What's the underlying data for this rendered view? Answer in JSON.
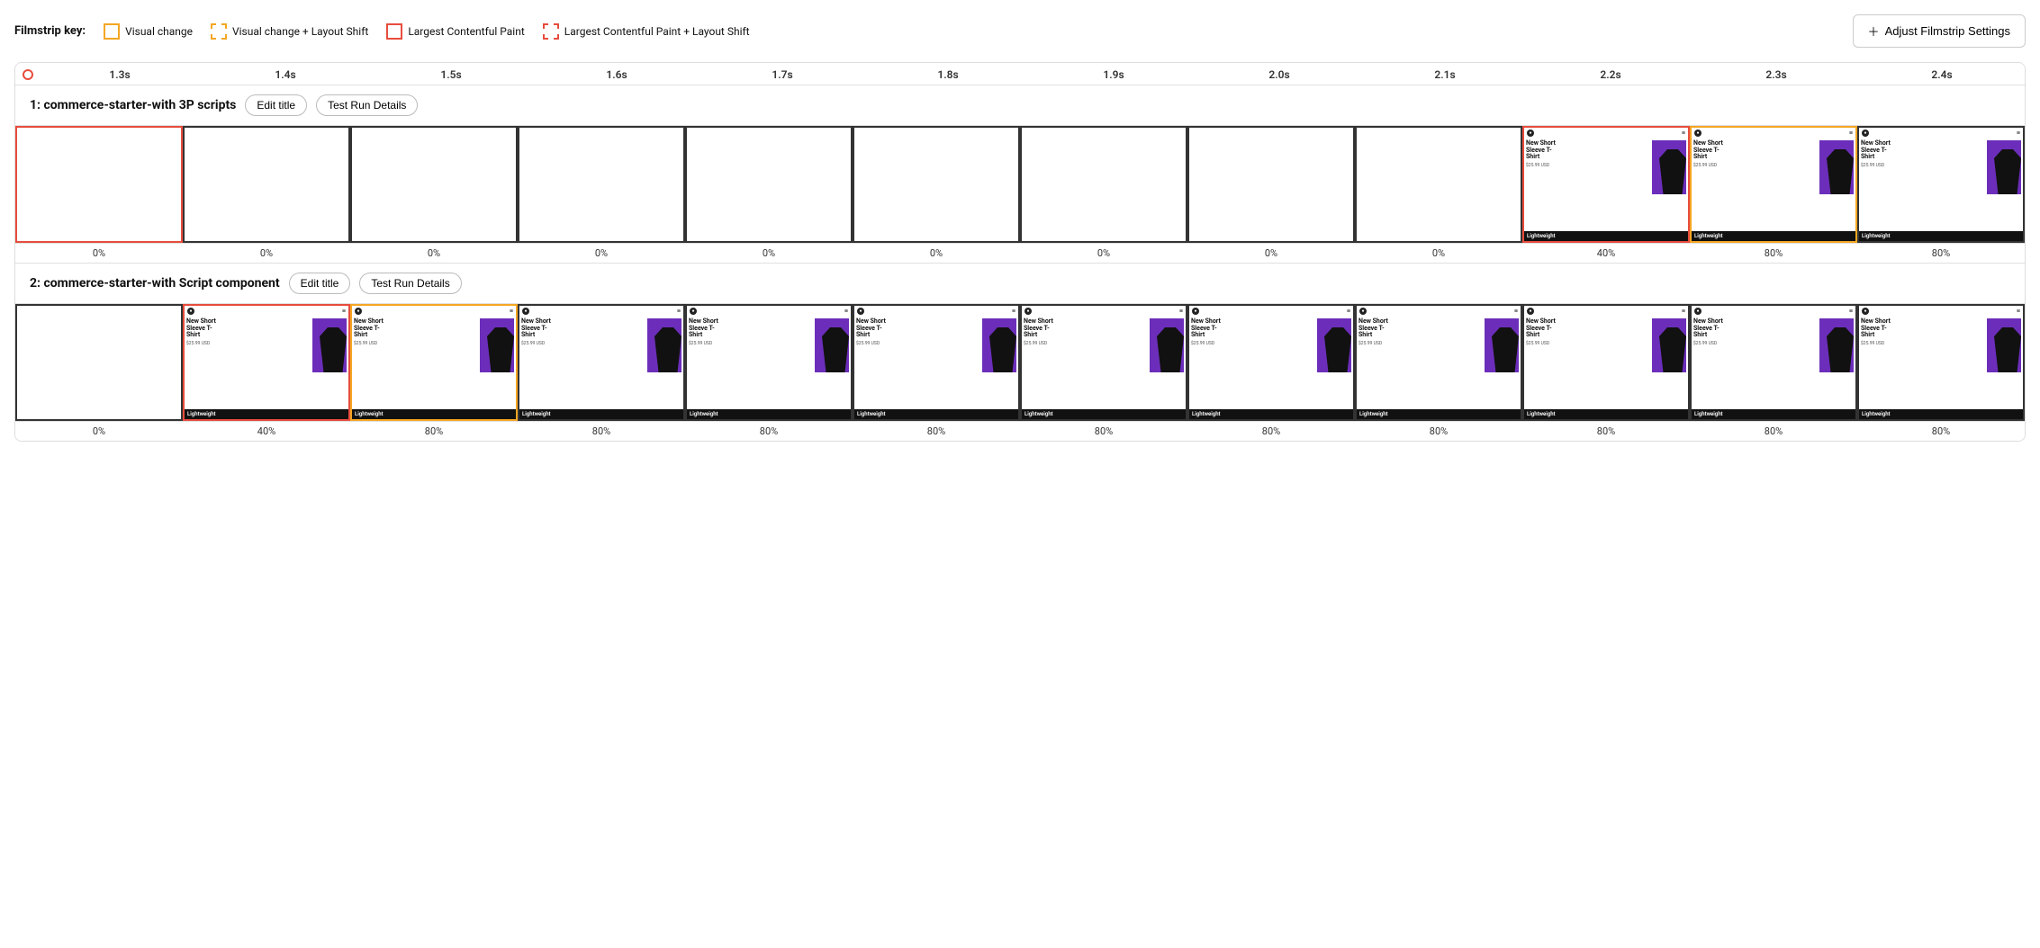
{
  "legend": {
    "label": "Filmstrip key:",
    "items": [
      {
        "id": "visual-change",
        "text": "Visual change",
        "border": "solid-yellow"
      },
      {
        "id": "visual-change-layout-shift",
        "text": "Visual change + Layout Shift",
        "border": "dashed-yellow"
      },
      {
        "id": "lcp",
        "text": "Largest Contentful Paint",
        "border": "solid-red"
      },
      {
        "id": "lcp-layout-shift",
        "text": "Largest Contentful Paint + Layout Shift",
        "border": "dashed-red"
      }
    ],
    "adjust_button": "Adjust Filmstrip Settings"
  },
  "timeline": {
    "ticks": [
      "1.3s",
      "1.4s",
      "1.5s",
      "1.6s",
      "1.7s",
      "1.8s",
      "1.9s",
      "2.0s",
      "2.1s",
      "2.2s",
      "2.3s",
      "2.4s"
    ]
  },
  "run1": {
    "title": "1: commerce-starter-with 3P scripts",
    "edit_title_label": "Edit title",
    "test_run_details_label": "Test Run Details",
    "frames": [
      {
        "id": "f1-1",
        "border": "red-solid",
        "has_content": false,
        "percent": "0%"
      },
      {
        "id": "f1-2",
        "border": "black",
        "has_content": false,
        "percent": "0%"
      },
      {
        "id": "f1-3",
        "border": "black",
        "has_content": false,
        "percent": "0%"
      },
      {
        "id": "f1-4",
        "border": "black",
        "has_content": false,
        "percent": "0%"
      },
      {
        "id": "f1-5",
        "border": "black",
        "has_content": false,
        "percent": "0%"
      },
      {
        "id": "f1-6",
        "border": "black",
        "has_content": false,
        "percent": "0%"
      },
      {
        "id": "f1-7",
        "border": "black",
        "has_content": false,
        "percent": "0%"
      },
      {
        "id": "f1-8",
        "border": "black",
        "has_content": false,
        "percent": "0%"
      },
      {
        "id": "f1-9",
        "border": "black",
        "has_content": false,
        "percent": "0%"
      },
      {
        "id": "f1-10",
        "border": "red-solid",
        "has_content": true,
        "percent": "40%"
      },
      {
        "id": "f1-11",
        "border": "yellow-solid",
        "has_content": true,
        "percent": "80%"
      },
      {
        "id": "f1-12",
        "border": "black",
        "has_content": true,
        "percent": "80%"
      }
    ]
  },
  "run2": {
    "title": "2: commerce-starter-with Script component",
    "edit_title_label": "Edit title",
    "test_run_details_label": "Test Run Details",
    "frames": [
      {
        "id": "f2-1",
        "border": "black",
        "has_content": false,
        "percent": "0%"
      },
      {
        "id": "f2-2",
        "border": "red-solid",
        "has_content": true,
        "percent": "40%"
      },
      {
        "id": "f2-3",
        "border": "yellow-solid",
        "has_content": true,
        "percent": "80%"
      },
      {
        "id": "f2-4",
        "border": "black",
        "has_content": true,
        "percent": "80%"
      },
      {
        "id": "f2-5",
        "border": "black",
        "has_content": true,
        "percent": "80%"
      },
      {
        "id": "f2-6",
        "border": "black",
        "has_content": true,
        "percent": "80%"
      },
      {
        "id": "f2-7",
        "border": "black",
        "has_content": true,
        "percent": "80%"
      },
      {
        "id": "f2-8",
        "border": "black",
        "has_content": true,
        "percent": "80%"
      },
      {
        "id": "f2-9",
        "border": "black",
        "has_content": true,
        "percent": "80%"
      },
      {
        "id": "f2-10",
        "border": "black",
        "has_content": true,
        "percent": "80%"
      },
      {
        "id": "f2-11",
        "border": "black",
        "has_content": true,
        "percent": "80%"
      },
      {
        "id": "f2-12",
        "border": "black",
        "has_content": true,
        "percent": "80%"
      }
    ]
  },
  "product": {
    "title_line1": "New Short",
    "title_line2": "Sleeve T-",
    "title_line3": "Shirt",
    "price": "$25.99 USD",
    "footer": "Lightweight"
  }
}
